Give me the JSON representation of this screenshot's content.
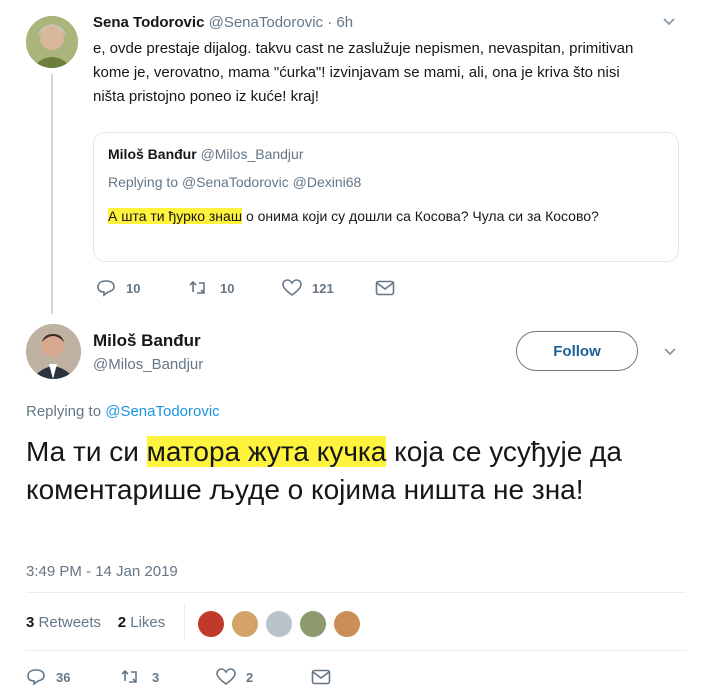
{
  "parent_tweet": {
    "author_name": "Sena Todorovic",
    "author_handle": "@SenaTodorovic",
    "time": "· 6h",
    "text": "e, ovde prestaje dijalog. takvu cast ne zaslužuje nepismen, nevaspitan, primitivan kome je, verovatno, mama \"ćurka\"!  izvinjavam se mami, ali, ona je kriva što nisi ništa pristojno poneo iz kuće! kraj!",
    "quoted": {
      "author_name": "Miloš Banđur",
      "author_handle": "@Milos_Bandjur",
      "replying_label": "Replying to",
      "replying_handles": "@SenaTodorovic @Dexini68",
      "text_highlight": "А шта ти ђурко знаш",
      "text_rest": " о онима који су дошли са Косова? Чула си за Косово?"
    },
    "actions": {
      "replies": "10",
      "retweets": "10",
      "likes": "121"
    }
  },
  "main_tweet": {
    "author_name": "Miloš Banđur",
    "author_handle": "@Milos_Bandjur",
    "follow_label": "Follow",
    "replying_label": "Replying to",
    "replying_handle": "@SenaTodorovic",
    "text_before": "Ма ти си ",
    "text_highlight": "матора жута кучка",
    "text_after": " која се усуђује да коментарише људе о којима ништа не зна!",
    "timestamp": "3:49 PM - 14 Jan 2019",
    "retweets_count": "3",
    "retweets_label": "Retweets",
    "likes_count": "2",
    "likes_label": "Likes",
    "actions": {
      "replies": "36",
      "retweets": "3",
      "likes": "2"
    }
  },
  "colors": {
    "link": "#1b95e0",
    "muted": "#657786",
    "highlight": "#fff33d",
    "thread_line": "#ccd6dd"
  }
}
